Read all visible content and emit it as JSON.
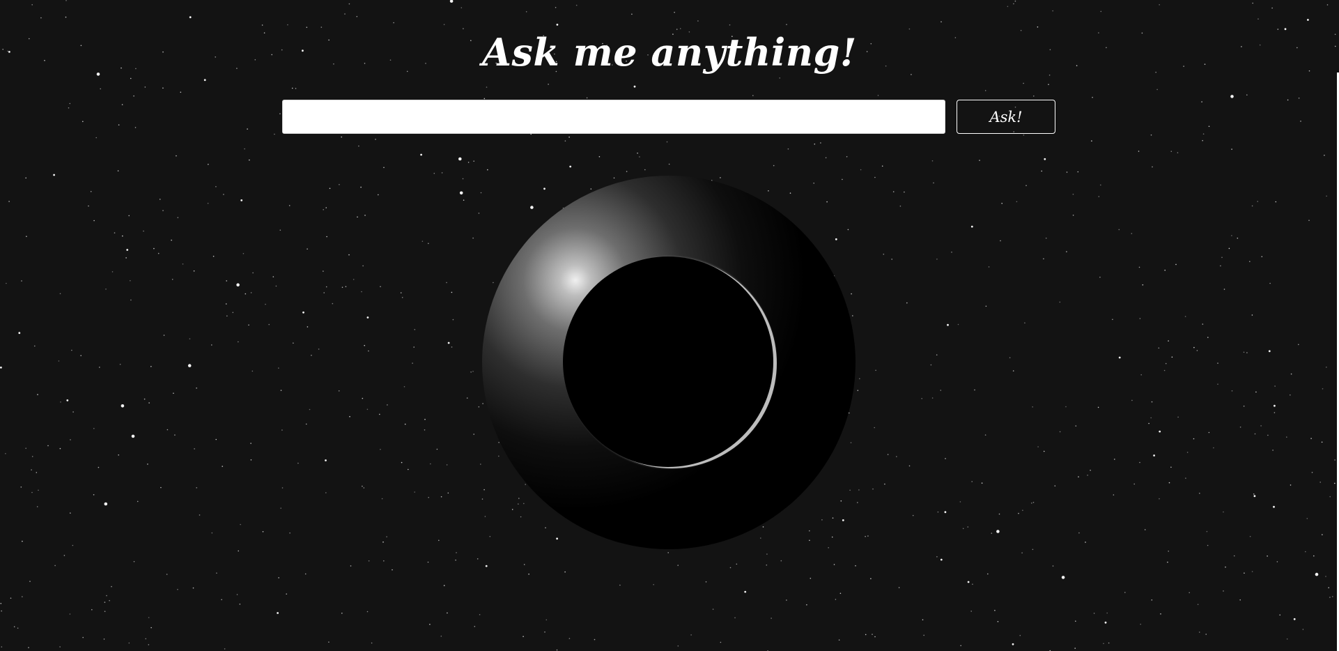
{
  "app": {
    "title": "Ask me anything!"
  },
  "question": {
    "value": "",
    "placeholder": ""
  },
  "ask_button": {
    "label": "Ask!"
  },
  "magic_ball": {
    "answer": "",
    "colors": {
      "highlight": "#f0f0f0",
      "body": "#000000",
      "rim": "#bdbdbd"
    }
  },
  "theme": {
    "background": "#131313",
    "star": "#ffffff",
    "text": "#ffffff"
  }
}
